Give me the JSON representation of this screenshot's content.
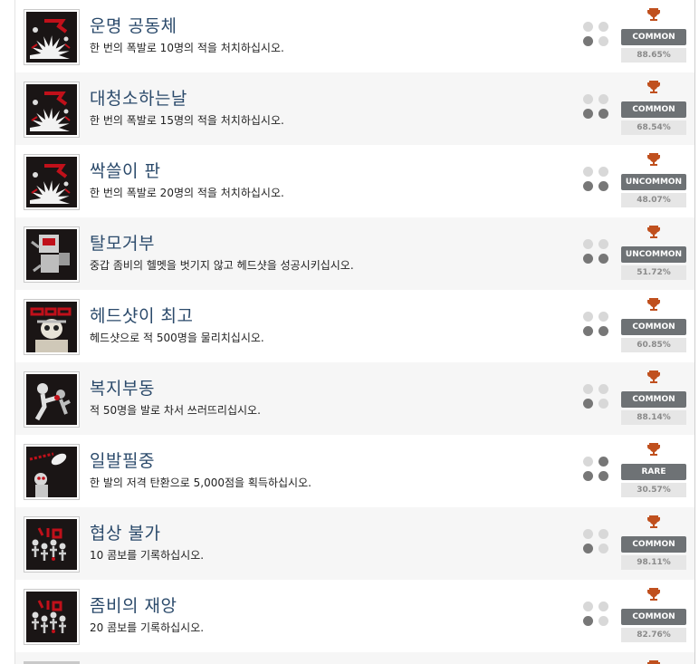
{
  "achievements": [
    {
      "title": "운명 공동체",
      "description": "한 번의 폭발로 10명의 적을 처치하십시오.",
      "rarity": "COMMON",
      "percent": "88.65%",
      "icon": "explosion-10-icon",
      "dots": [
        false,
        false,
        true,
        false
      ]
    },
    {
      "title": "대청소하는날",
      "description": "한 번의 폭발로 15명의 적을 처치하십시오.",
      "rarity": "COMMON",
      "percent": "68.54%",
      "icon": "explosion-15-icon",
      "dots": [
        false,
        false,
        true,
        true
      ]
    },
    {
      "title": "싹쓸이 판",
      "description": "한 번의 폭발로 20명의 적을 처치하십시오.",
      "rarity": "UNCOMMON",
      "percent": "48.07%",
      "icon": "explosion-20-icon",
      "dots": [
        false,
        false,
        true,
        true
      ]
    },
    {
      "title": "탈모거부",
      "description": "중갑 좀비의 헬멧을 벗기지 않고 헤드샷을 성공시키십시오.",
      "rarity": "UNCOMMON",
      "percent": "51.72%",
      "icon": "helmet-zombie-icon",
      "dots": [
        false,
        false,
        true,
        true
      ]
    },
    {
      "title": "헤드샷이 최고",
      "description": "헤드샷으로 적 500명을 물리치십시오.",
      "rarity": "COMMON",
      "percent": "60.85%",
      "icon": "headshot-500-icon",
      "dots": [
        false,
        false,
        true,
        true
      ]
    },
    {
      "title": "복지부동",
      "description": "적 50명을 발로 차서 쓰러뜨리십시오.",
      "rarity": "COMMON",
      "percent": "88.14%",
      "icon": "kick-icon",
      "dots": [
        false,
        false,
        true,
        false
      ]
    },
    {
      "title": "일발필중",
      "description": "한 발의 저격 탄환으로 5,000점을 획득하십시오.",
      "rarity": "RARE",
      "percent": "30.57%",
      "icon": "sniper-bullet-icon",
      "dots": [
        false,
        true,
        true,
        true
      ]
    },
    {
      "title": "협상 불가",
      "description": "10 콤보를 기록하십시오.",
      "rarity": "COMMON",
      "percent": "98.11%",
      "icon": "combo-10-icon",
      "dots": [
        false,
        false,
        true,
        false
      ]
    },
    {
      "title": "좀비의 재앙",
      "description": "20 콤보를 기록하십시오.",
      "rarity": "COMMON",
      "percent": "82.76%",
      "icon": "combo-20-icon",
      "dots": [
        false,
        false,
        true,
        false
      ]
    }
  ],
  "colors": {
    "title": "#2b4a6b",
    "badge": "#6e7275",
    "trophy": "#c0501e",
    "icon_bg": "#1a1515",
    "icon_red": "#c0101a"
  }
}
